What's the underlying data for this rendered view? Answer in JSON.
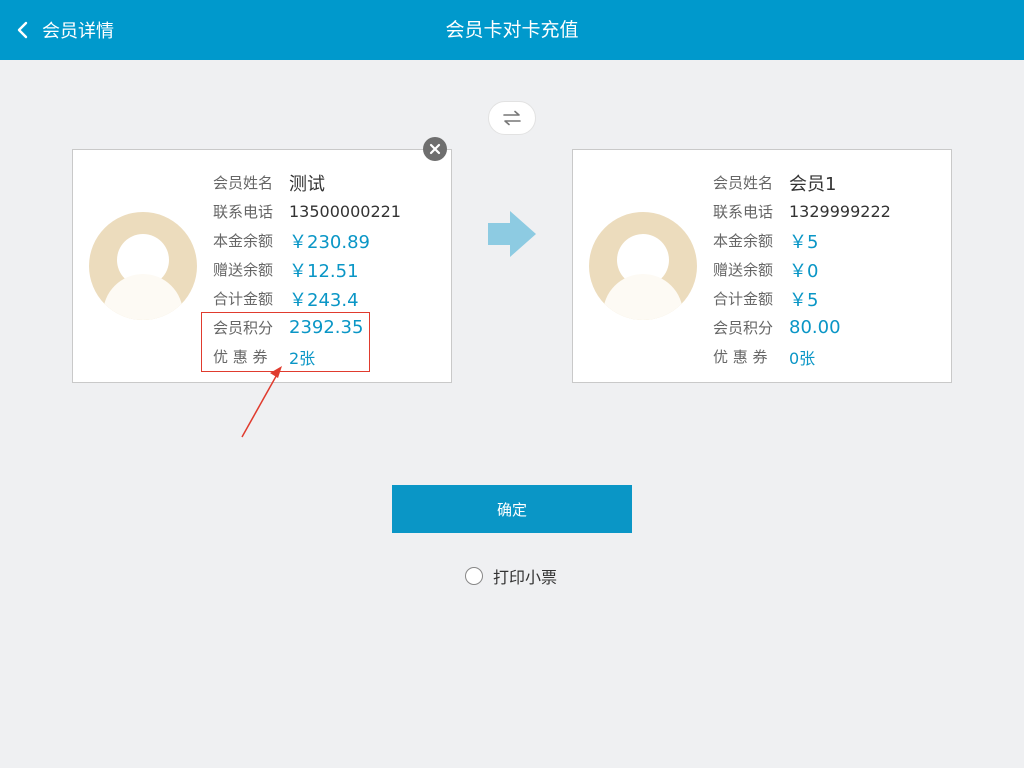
{
  "header": {
    "back_label": "会员详情",
    "title": "会员卡对卡充值",
    "bg_color": "#0099cc"
  },
  "swap_icon": "swap-arrows-icon",
  "labels": {
    "name": "会员姓名",
    "phone": "联系电话",
    "principal": "本金余额",
    "gift": "赠送余额",
    "total": "合计金额",
    "points": "会员积分",
    "coupon": "优 惠 券"
  },
  "source_card": {
    "name": "测试",
    "phone": "13500000221",
    "principal": "￥230.89",
    "gift": "￥12.51",
    "total": "￥243.4",
    "points": "2392.35",
    "coupon": "2张"
  },
  "target_card": {
    "name": "会员1",
    "phone": "1329999222",
    "principal": "￥5",
    "gift": "￥0",
    "total": "￥5",
    "points": "80.00",
    "coupon": "0张"
  },
  "confirm_label": "确定",
  "print_label": "打印小票",
  "colors": {
    "accent": "#0a96c6",
    "annotation": "#e03b2e",
    "arrow": "#8dcbe2",
    "avatar": "#ecdcbd"
  }
}
